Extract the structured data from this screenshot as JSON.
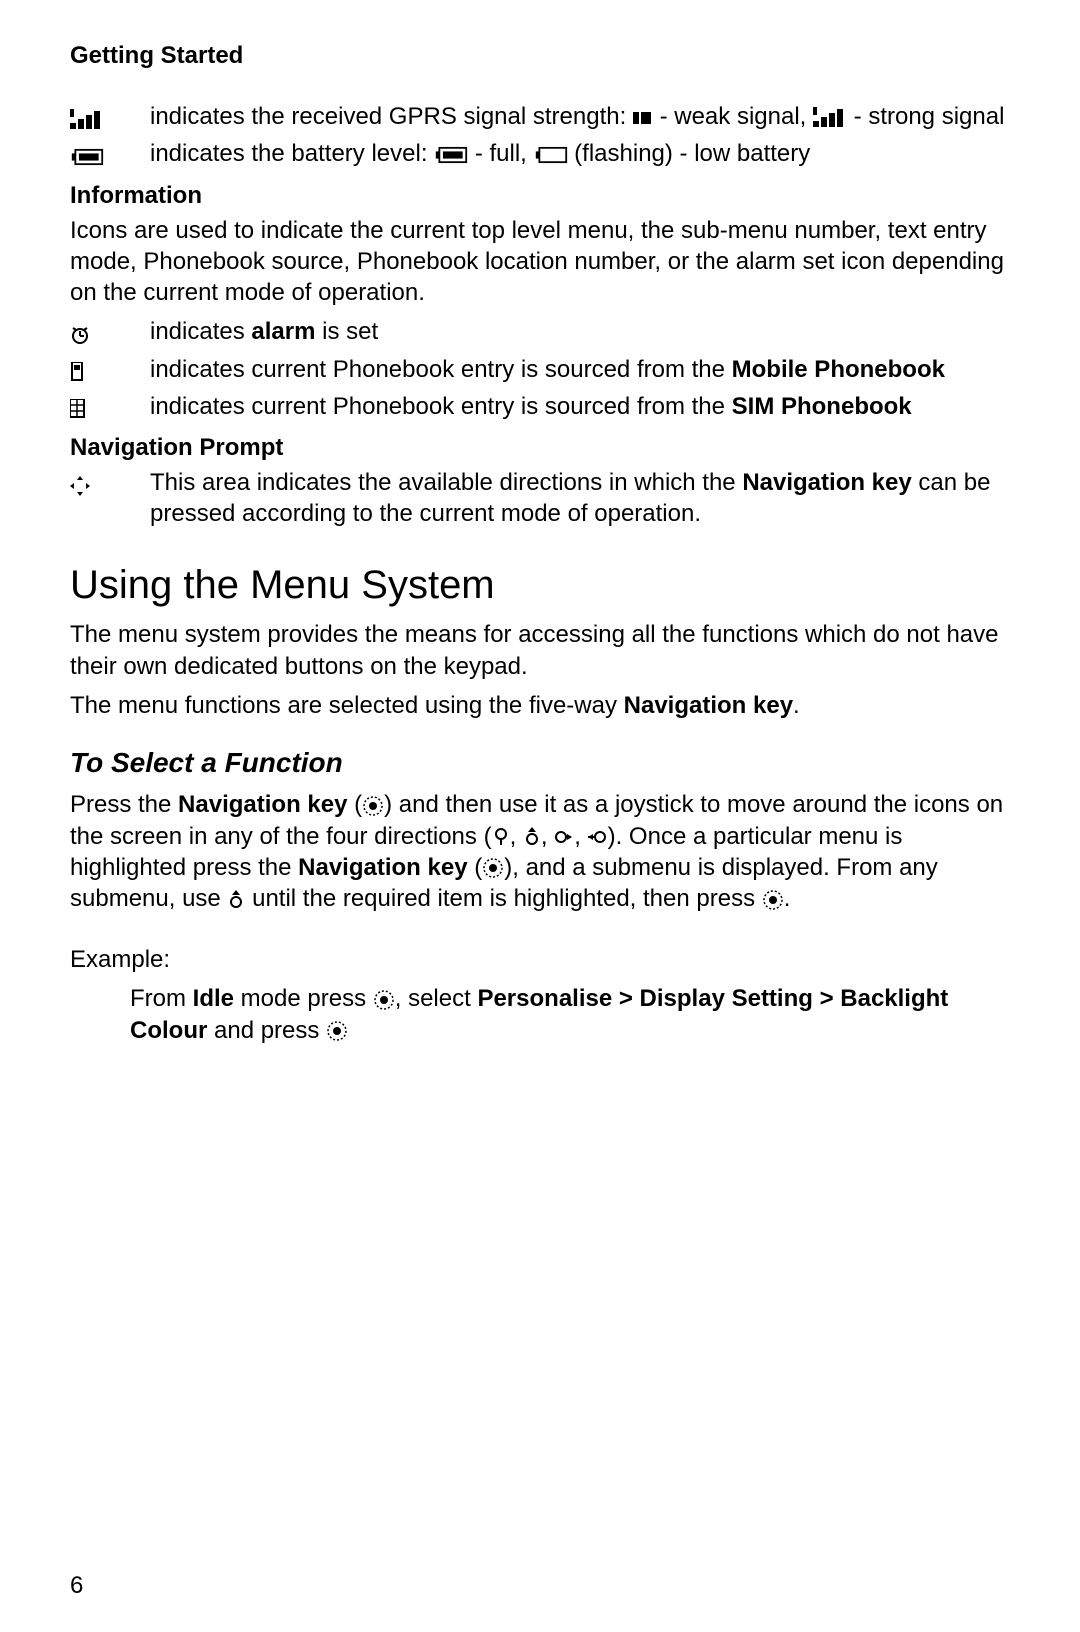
{
  "header": "Getting Started",
  "gprs": {
    "prefix": "indicates the received GPRS signal strength: ",
    "weak": " - weak signal, ",
    "strong": " - strong signal"
  },
  "battery": {
    "prefix": "indicates the battery level: ",
    "full": " - full, ",
    "low": " (flashing) - low battery"
  },
  "info_heading": "Information",
  "info_body": "Icons are used to indicate the current top level menu, the sub-menu number, text entry mode, Phonebook source, Phonebook location number, or the alarm set icon depending on the current mode of operation.",
  "alarm": {
    "pre": "indicates ",
    "bold": "alarm",
    "post": " is set"
  },
  "mobile_pb": {
    "pre": "indicates current Phonebook entry is sourced from the ",
    "bold": "Mobile Phonebook"
  },
  "sim_pb": {
    "pre": "indicates current Phonebook entry is sourced from the ",
    "bold": "SIM Phonebook"
  },
  "nav_heading": "Navigation Prompt",
  "nav_body": {
    "pre": "This area indicates the available directions in which the ",
    "bold": "Navigation key",
    "post": " can be pressed according to the current mode of operation."
  },
  "menu_heading": "Using the Menu System",
  "menu_p1": "The menu system provides the means for accessing all the functions which do not have their own dedicated buttons on the keypad.",
  "menu_p2": {
    "pre": "The menu functions are selected using the five-way ",
    "bold": "Navigation key",
    "post": "."
  },
  "select_heading": "To Select a Function",
  "select_body": {
    "t1": "Press the ",
    "navkey": "Navigation key",
    "t2": " (",
    "t3": ") and then use it as a joystick to move around the icons on the screen in any of the four directions (",
    "comma": ", ",
    "t4": "). Once a particular menu is highlighted press the ",
    "t5": " (",
    "t6": "), and a submenu is displayed. From any submenu, use ",
    "t7": " until the required item is highlighted, then press ",
    "t8": "."
  },
  "example_label": "Example:",
  "example": {
    "t1": "From ",
    "idle": "Idle",
    "t2": " mode press ",
    "t3": ", select ",
    "path": "Personalise > Display Setting > Backlight Colour",
    "t4": " and press "
  },
  "page_number": "6"
}
